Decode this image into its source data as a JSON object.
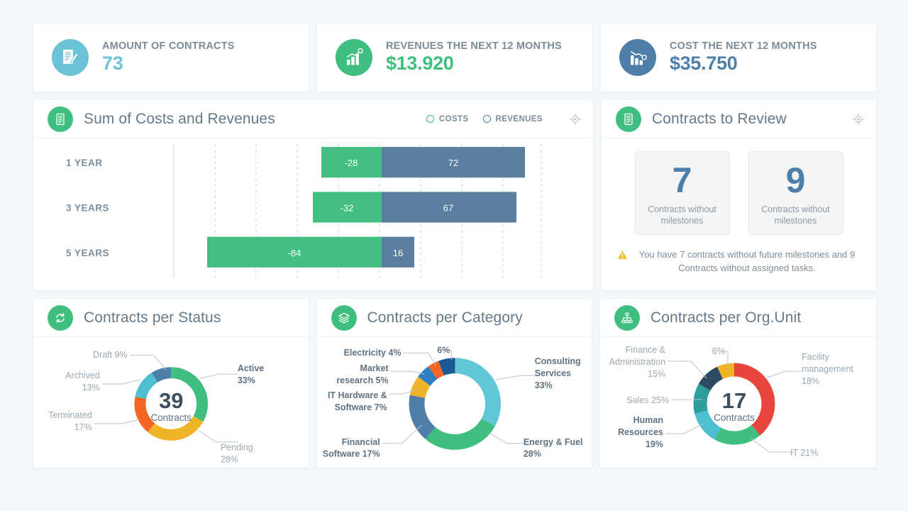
{
  "kpis": [
    {
      "label": "AMOUNT OF CONTRACTS",
      "value": "73",
      "color": "#6cc3d5",
      "icon": "document-pen-icon"
    },
    {
      "label": "REVENUES THE NEXT 12 MONTHS",
      "value": "$13.920",
      "color": "#3fbf7f",
      "icon": "bar-chart-up-icon"
    },
    {
      "label": "COST THE NEXT 12  MONTHS",
      "value": "$35.750",
      "color": "#4e7fa8",
      "icon": "bar-chart-down-icon"
    }
  ],
  "costs_panel": {
    "title": "Sum of Costs and Revenues",
    "icon": "document-list-icon",
    "legend": [
      {
        "label": "COSTS",
        "color": "#3fbf7f"
      },
      {
        "label": "REVENUES",
        "color": "#4e7fa8"
      }
    ],
    "target_icon": "crosshair-icon"
  },
  "review_panel": {
    "title": "Contracts to Review",
    "icon": "document-list-icon",
    "target_icon": "crosshair-icon",
    "tiles": [
      {
        "number": "7",
        "caption": "Contracts without milestones"
      },
      {
        "number": "9",
        "caption": "Contracts without milestones"
      }
    ],
    "warning_icon": "warning-triangle-icon",
    "warning_text": "You have 7 contracts without future milestones and 9 Contracts without assigned tasks."
  },
  "status_panel": {
    "title": "Contracts per Status",
    "icon": "refresh-cycle-icon"
  },
  "category_panel": {
    "title": "Contracts per Category",
    "icon": "layers-icon"
  },
  "orgunit_panel": {
    "title": "Contracts per Org.Unit",
    "icon": "org-hierarchy-icon"
  },
  "chart_data": [
    {
      "type": "bar",
      "title": "Sum of Costs and Revenues",
      "orientation": "horizontal",
      "stacked": false,
      "categories": [
        "1 YEAR",
        "3 YEARS",
        "5 YEARS"
      ],
      "series": [
        {
          "name": "COSTS",
          "color": "#3fbf7f",
          "values": [
            -28,
            -32,
            -84
          ]
        },
        {
          "name": "REVENUES",
          "color": "#5a7f9e",
          "values": [
            72,
            67,
            16
          ]
        }
      ],
      "xlabel": "",
      "ylabel": "",
      "xlim": [
        -120,
        120
      ],
      "grid": true,
      "grid_style": "dashed-vertical",
      "legend_position": "top-right"
    },
    {
      "type": "pie",
      "title": "Contracts per Status",
      "center_value": "39",
      "center_label": "Contracts",
      "labels": [
        "Active",
        "Pending",
        "Terminated",
        "Archived",
        "Draft"
      ],
      "values": [
        33,
        28,
        17,
        13,
        9
      ],
      "display": [
        "Active 33%",
        "Pending 28%",
        "Terminated 17%",
        "Archived 13%",
        "Draft 9%"
      ],
      "colors": [
        "#3fbf7f",
        "#f0b429",
        "#f26522",
        "#4dbfd0",
        "#4e7fa8"
      ],
      "unit": "%"
    },
    {
      "type": "pie",
      "title": "Contracts per Category",
      "center_value": "",
      "center_label": "",
      "labels": [
        "Consulting Services",
        "Energy & Fuel",
        "Financial Software",
        "IT Hardware & Software",
        "Market research",
        "Electricity",
        ""
      ],
      "values": [
        33,
        28,
        17,
        7,
        5,
        4,
        6
      ],
      "display": [
        "Consulting Services 33%",
        "Energy & Fuel 28%",
        "Financial Software 17%",
        "IT Hardware & Software 7%",
        "Market research 5%",
        "Electricity 4%",
        "6%"
      ],
      "colors": [
        "#61c6d6",
        "#3fbf7f",
        "#4e7fa8",
        "#f0b429",
        "#2e7fc4",
        "#f26522",
        "#1c5a96"
      ],
      "unit": "%"
    },
    {
      "type": "pie",
      "title": "Contracts per Org.Unit",
      "center_value": "17",
      "center_label": "Contracts",
      "labels": [
        "Facility management",
        "IT",
        "Human Resources",
        "Sales",
        "Finance & Administration",
        ""
      ],
      "values": [
        18,
        21,
        19,
        25,
        15,
        6
      ],
      "display": [
        "Facility management 18%",
        "IT 21%",
        "Human Resources 19%",
        "Sales 25%",
        "Finance & Administration 15%",
        "6%"
      ],
      "colors": [
        "#e8453c",
        "#e8453c",
        "#3fbf7f",
        "#4dbfd0",
        "#2e9d9d",
        "#2c4a63",
        "#f0b429"
      ],
      "unit": "%"
    }
  ]
}
